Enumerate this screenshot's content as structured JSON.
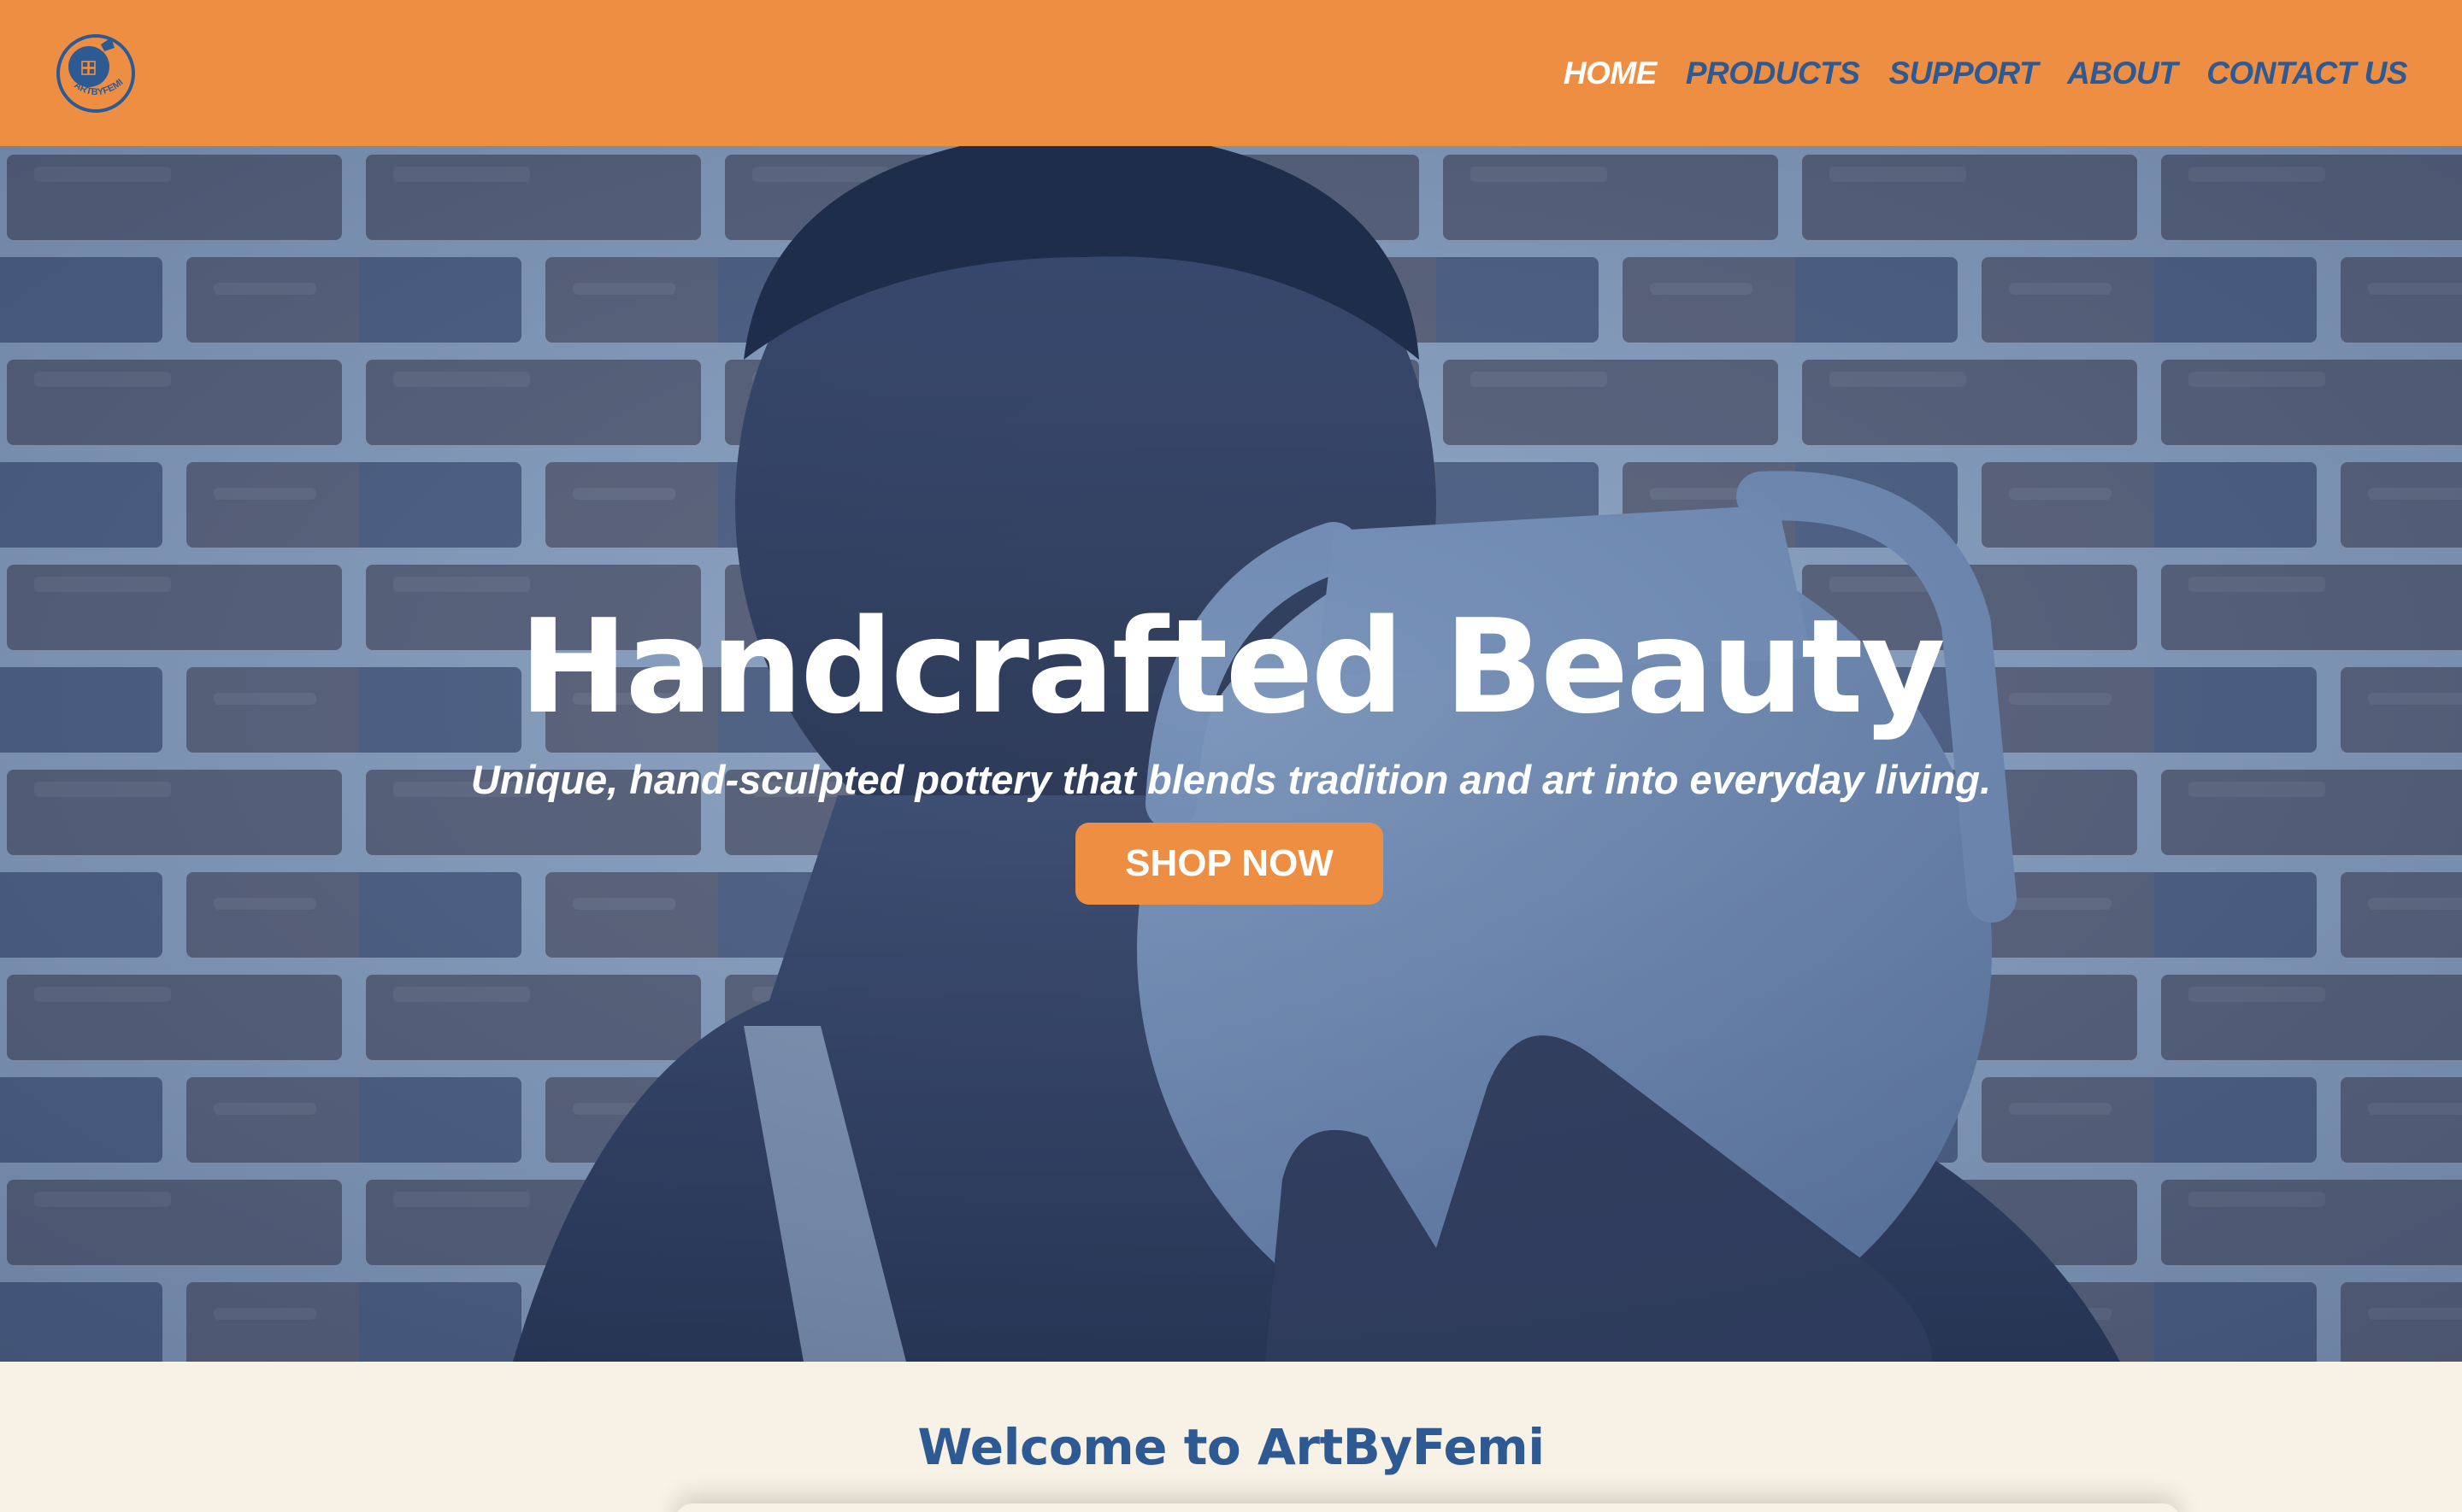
{
  "brand": {
    "logo_text": "ARTBYFEMI",
    "primary_color": "#ee8e43",
    "accent_color": "#2e5a94",
    "background_color": "#f8f1e5"
  },
  "nav": {
    "items": [
      {
        "label": "HOME",
        "active": true
      },
      {
        "label": "PRODUCTS",
        "active": false
      },
      {
        "label": "SUPPORT",
        "active": false
      },
      {
        "label": "ABOUT",
        "active": false
      },
      {
        "label": "CONTACT US",
        "active": false
      }
    ]
  },
  "hero": {
    "title": "Handcrafted Beauty",
    "subtitle": "Unique, hand-sculpted pottery that blends tradition and art into everyday living.",
    "cta_label": "SHOP NOW",
    "image_alt": "Man holding a handcrafted clay pot in front of a brick wall"
  },
  "welcome": {
    "title": "Welcome to ArtByFemi"
  }
}
